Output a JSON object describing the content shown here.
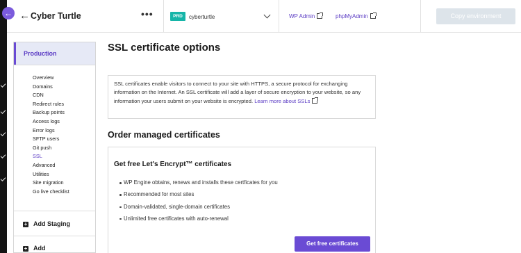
{
  "header": {
    "site_name": "Cyber Turtle",
    "more_icon": "more-horizontal-icon",
    "env_badge": "PRD",
    "env_name": "cyberturtle",
    "links": [
      "WP Admin",
      "phpMyAdmin"
    ],
    "copy_environment": "Copy environment"
  },
  "sidebar": {
    "environment": "Production",
    "items": [
      "Overview",
      "Domains",
      "CDN",
      "Redirect rules",
      "Backup points",
      "Access logs",
      "Error logs",
      "SFTP users",
      "Git push",
      "SSL",
      "Advanced",
      "Utilities",
      "Site migration",
      "Go live checklist"
    ],
    "active_item": "SSL",
    "add_staging": "Add Staging",
    "add_more": "Add"
  },
  "main": {
    "title": "SSL certificate options",
    "info_text": "SSL certificates enable visitors to connect to your site with HTTPS, a secure protocol for exchanging information on the Internet. An SSL certificate will add a layer of secure encryption to your website, so any information your users submit on your website is encrypted.",
    "learn_more": "Learn more about SSLs",
    "section_title": "Order managed certificates",
    "card": {
      "title": "Get free Let's Encrypt™ certificates",
      "bullets": [
        "WP Engine obtains, renews and installs these certficates for you",
        "Recommended for most sites",
        "Domain-validated, single-domain certificates",
        "Unlimited free certificates with auto-renewal"
      ],
      "button": "Get free certificates"
    }
  },
  "colors": {
    "accent": "#6a4bd4",
    "env_badge": "#16b5a8",
    "disabled_button": "#dde4ea",
    "rail": "#141414"
  }
}
